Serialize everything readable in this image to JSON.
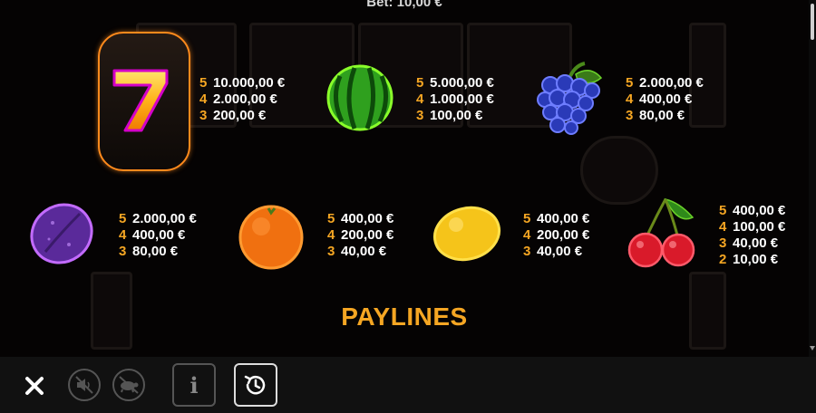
{
  "header": {
    "bet_text": "Bet: 10,00 €"
  },
  "symbols": [
    {
      "name": "seven",
      "pays": [
        {
          "count": "5",
          "amount": "10.000,00 €"
        },
        {
          "count": "4",
          "amount": "2.000,00 €"
        },
        {
          "count": "3",
          "amount": "200,00 €"
        }
      ]
    },
    {
      "name": "watermelon",
      "pays": [
        {
          "count": "5",
          "amount": "5.000,00 €"
        },
        {
          "count": "4",
          "amount": "1.000,00 €"
        },
        {
          "count": "3",
          "amount": "100,00 €"
        }
      ]
    },
    {
      "name": "grapes",
      "pays": [
        {
          "count": "5",
          "amount": "2.000,00 €"
        },
        {
          "count": "4",
          "amount": "400,00 €"
        },
        {
          "count": "3",
          "amount": "80,00 €"
        }
      ]
    },
    {
      "name": "plum",
      "pays": [
        {
          "count": "5",
          "amount": "2.000,00 €"
        },
        {
          "count": "4",
          "amount": "400,00 €"
        },
        {
          "count": "3",
          "amount": "80,00 €"
        }
      ]
    },
    {
      "name": "orange",
      "pays": [
        {
          "count": "5",
          "amount": "400,00 €"
        },
        {
          "count": "4",
          "amount": "200,00 €"
        },
        {
          "count": "3",
          "amount": "40,00 €"
        }
      ]
    },
    {
      "name": "lemon",
      "pays": [
        {
          "count": "5",
          "amount": "400,00 €"
        },
        {
          "count": "4",
          "amount": "200,00 €"
        },
        {
          "count": "3",
          "amount": "40,00 €"
        }
      ]
    },
    {
      "name": "cherry",
      "pays": [
        {
          "count": "5",
          "amount": "400,00 €"
        },
        {
          "count": "4",
          "amount": "100,00 €"
        },
        {
          "count": "3",
          "amount": "40,00 €"
        },
        {
          "count": "2",
          "amount": "10,00 €"
        }
      ]
    }
  ],
  "section_title": "PAYLINES",
  "colors": {
    "accent": "#f5a623",
    "text": "#ffffff",
    "background": "#000000",
    "bar": "#111111"
  },
  "toolbar": {
    "close_icon": "close-icon",
    "sound_icon": "sound-muted-icon",
    "turbo_icon": "turtle-icon",
    "info_label": "i",
    "history_icon": "history-icon"
  }
}
